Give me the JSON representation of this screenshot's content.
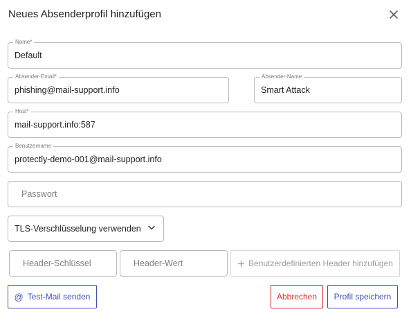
{
  "dialog": {
    "title": "Neues Absenderprofil hinzufügen",
    "close_icon": "close-icon"
  },
  "form": {
    "name": {
      "label": "Name*",
      "value": "Default"
    },
    "sender_email": {
      "label": "Absender-Email*",
      "value": "phishing@mail-support.info"
    },
    "sender_name": {
      "label": "Absender-Name",
      "value": "Smart Attack"
    },
    "host": {
      "label": "Host*",
      "value": "mail-support.info:587"
    },
    "username": {
      "label": "Benutzername",
      "value": "protectly-demo-001@mail-support.info"
    },
    "password": {
      "placeholder": "Passwort"
    },
    "tls_select": {
      "value": "TLS-Verschlüsselung verwenden",
      "icon": "chevron-down-icon"
    },
    "header_key": {
      "placeholder": "Header-Schlüssel"
    },
    "header_value": {
      "placeholder": "Header-Wert"
    },
    "add_header_button": {
      "label": "Benutzerdefinierten Header hinzufügen",
      "icon": "plus-icon"
    }
  },
  "actions": {
    "test_mail": {
      "label": "Test-Mail senden",
      "icon": "at-icon"
    },
    "cancel": {
      "label": "Abbrechen"
    },
    "save": {
      "label": "Profil speichern"
    }
  },
  "colors": {
    "primary": "#3f51b5",
    "danger": "#d32f2f",
    "border": "#b9b9b9",
    "disabled": "#9e9e9e"
  }
}
